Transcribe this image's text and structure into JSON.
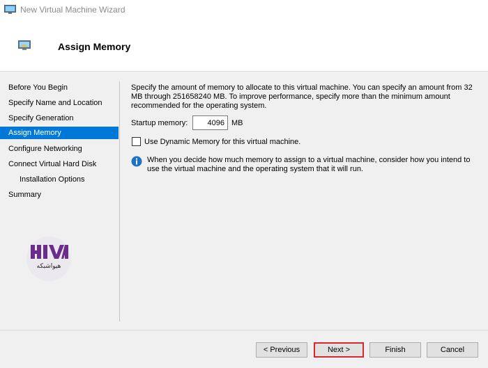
{
  "window": {
    "title": "New Virtual Machine Wizard",
    "icon": "vm-wizard-icon"
  },
  "header": {
    "title": "Assign Memory",
    "icon": "monitor-icon"
  },
  "nav": {
    "items": [
      {
        "label": "Before You Begin"
      },
      {
        "label": "Specify Name and Location"
      },
      {
        "label": "Specify Generation"
      },
      {
        "label": "Assign Memory",
        "active": true
      },
      {
        "label": "Configure Networking"
      },
      {
        "label": "Connect Virtual Hard Disk"
      },
      {
        "label": "Installation Options",
        "sub": true
      },
      {
        "label": "Summary"
      }
    ]
  },
  "logo": {
    "brand": "HIVA",
    "subtitle": "هیواشبکه"
  },
  "main": {
    "description": "Specify the amount of memory to allocate to this virtual machine. You can specify an amount from 32 MB through 251658240 MB. To improve performance, specify more than the minimum amount recommended for the operating system.",
    "startup_memory_label": "Startup memory:",
    "startup_memory_value": "4096",
    "startup_memory_unit": "MB",
    "dynamic_memory_label": "Use Dynamic Memory for this virtual machine.",
    "dynamic_memory_checked": false,
    "info_text": "When you decide how much memory to assign to a virtual machine, consider how you intend to use the virtual machine and the operating system that it will run."
  },
  "buttons": {
    "previous": "< Previous",
    "next": "Next >",
    "finish": "Finish",
    "cancel": "Cancel"
  },
  "colors": {
    "accent": "#0078d7",
    "highlight_border": "#d9272e",
    "info_icon": "#1a73c8"
  }
}
